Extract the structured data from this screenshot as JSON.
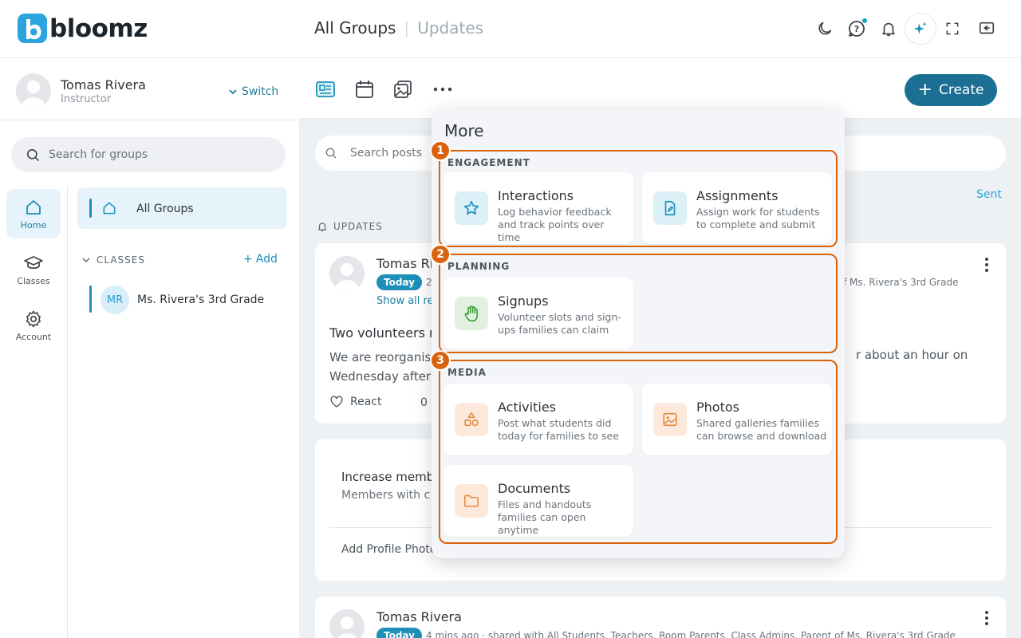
{
  "brand": {
    "name": "bloomz",
    "mark": "b"
  },
  "header": {
    "title": "All Groups",
    "subtitle": "Updates"
  },
  "user": {
    "name": "Tomas Rivera",
    "role": "Instructor",
    "switch_label": "Switch"
  },
  "sidebar": {
    "search_placeholder": "Search for groups",
    "rail": [
      {
        "label": "Home",
        "icon": "home-icon"
      },
      {
        "label": "Classes",
        "icon": "graduation-cap-icon"
      },
      {
        "label": "Account",
        "icon": "gear-icon"
      }
    ],
    "all_groups": "All Groups",
    "classes_header": "CLASSES",
    "add_label": "Add",
    "classes": [
      {
        "initials": "MR",
        "name": "Ms. Rivera's 3rd Grade"
      }
    ]
  },
  "main": {
    "create_label": "Create",
    "search_placeholder": "Search posts",
    "sent_label": "Sent",
    "updates_header": "UPDATES",
    "post1": {
      "author": "Tomas Ri",
      "badge": "Today",
      "meta_left": "2",
      "meta_right": "f Ms. Rivera's 3rd Grade",
      "show_all": "Show all re",
      "title": "Two volunteers n",
      "body_line1": "We are reorganis",
      "body_line2": "Wednesday after",
      "body_right": "r about an hour on",
      "react": "React",
      "count": "0"
    },
    "card2": {
      "title": "Increase memb",
      "subtitle": "Members with c",
      "link": "Add Profile Photo"
    },
    "post2": {
      "author": "Tomas Rivera",
      "badge": "Today",
      "meta": "4 mins ago · shared with All Students, Teachers, Room Parents, Class Admins, Parent of Ms. Rivera's 3rd Grade"
    }
  },
  "popup": {
    "title": "More",
    "sections": [
      {
        "number": "1",
        "label": "ENGAGEMENT",
        "items": [
          {
            "title": "Interactions",
            "desc": "Log behavior feedback and track points over time",
            "icon": "star-icon"
          },
          {
            "title": "Assignments",
            "desc": "Assign work for students to complete and submit",
            "icon": "document-edit-icon"
          }
        ]
      },
      {
        "number": "2",
        "label": "PLANNING",
        "items": [
          {
            "title": "Signups",
            "desc": "Volunteer slots and sign-ups families can claim",
            "icon": "hand-icon"
          }
        ]
      },
      {
        "number": "3",
        "label": "MEDIA",
        "items": [
          {
            "title": "Activities",
            "desc": "Post what students did today for families to see",
            "icon": "shapes-icon"
          },
          {
            "title": "Photos",
            "desc": "Shared galleries families can browse and download",
            "icon": "image-icon"
          },
          {
            "title": "Documents",
            "desc": "Files and handouts families can open anytime",
            "icon": "folder-icon"
          }
        ]
      }
    ]
  },
  "colors": {
    "primary": "#1a6f93",
    "accent": "#1d8fb9",
    "highlight": "#d9620f"
  }
}
